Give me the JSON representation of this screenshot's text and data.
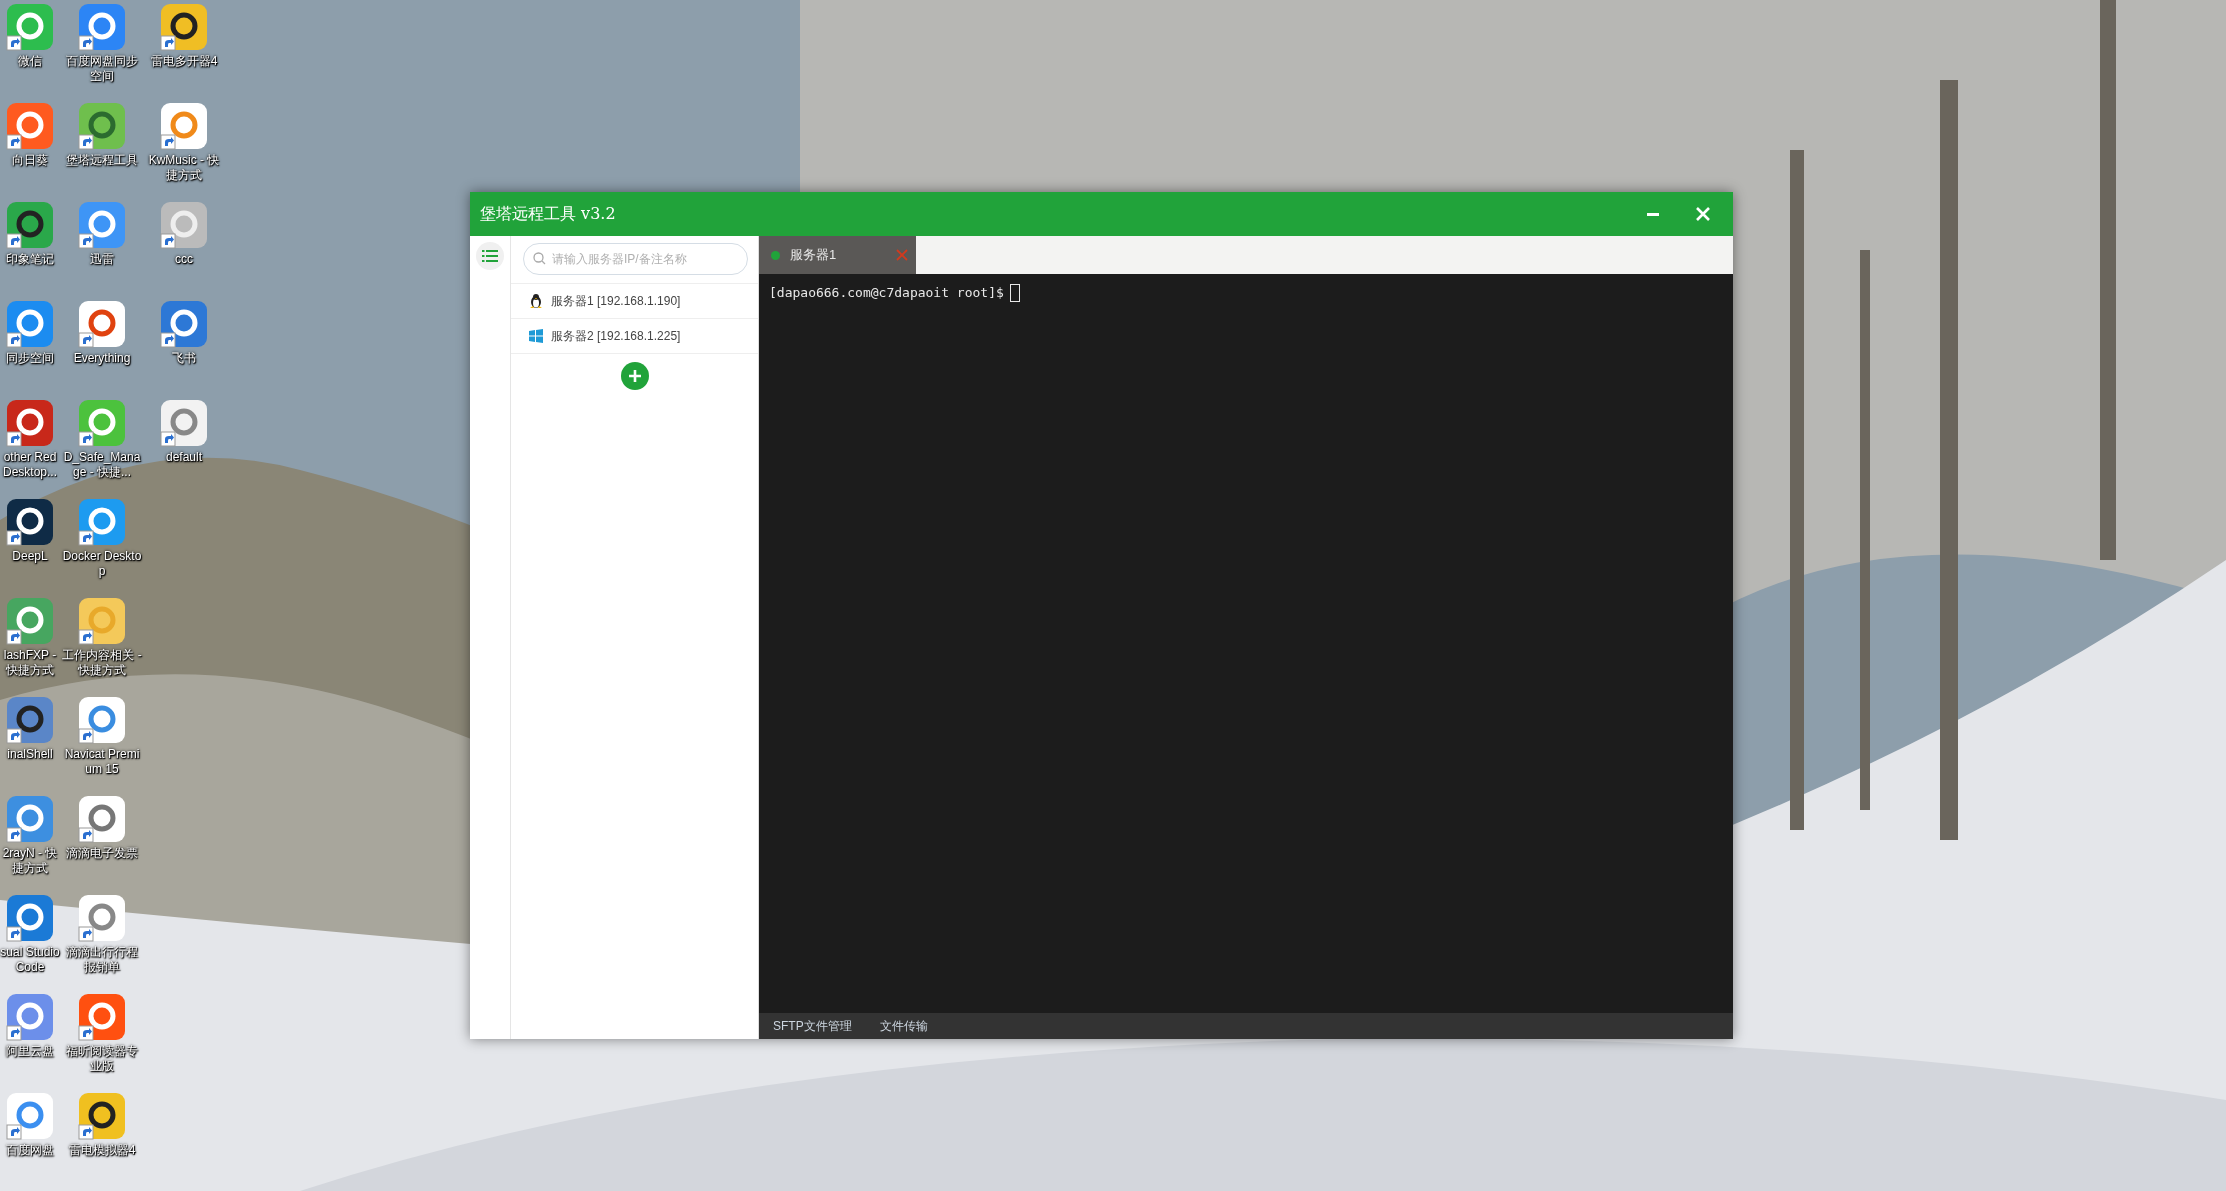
{
  "desktop": {
    "icons": [
      {
        "label": "微信"
      },
      {
        "label": "向日葵"
      },
      {
        "label": "印象笔记"
      },
      {
        "label": "同步空间"
      },
      {
        "label": "other Red Desktop..."
      },
      {
        "label": "DeepL"
      },
      {
        "label": "lashFXP - 快捷方式"
      },
      {
        "label": "inalShell"
      },
      {
        "label": "2rayN - 快捷方式"
      },
      {
        "label": "sual Studio Code"
      },
      {
        "label": "阿里云盘"
      },
      {
        "label": "百度网盘"
      },
      {
        "label": "百度网盘同步空间"
      },
      {
        "label": "堡塔远程工具"
      },
      {
        "label": "迅雷"
      },
      {
        "label": "Everything"
      },
      {
        "label": "D_Safe_Manage - 快捷..."
      },
      {
        "label": "Docker Desktop"
      },
      {
        "label": "工作内容相关 - 快捷方式"
      },
      {
        "label": "Navicat Premium 15"
      },
      {
        "label": "滴滴电子发票"
      },
      {
        "label": "滴滴出行行程报销单"
      },
      {
        "label": "福昕阅读器专业版"
      },
      {
        "label": "雷电模拟器4"
      },
      {
        "label": "雷电多开器4"
      },
      {
        "label": "KwMusic - 快捷方式"
      },
      {
        "label": "ccc"
      },
      {
        "label": "飞书"
      },
      {
        "label": "default"
      }
    ]
  },
  "window": {
    "title": "堡塔远程工具 v3.2",
    "search": {
      "placeholder": "请输入服务器IP/备注名称"
    },
    "servers": [
      {
        "name": "服务器1 [192.168.1.190]",
        "kind": "linux"
      },
      {
        "name": "服务器2 [192.168.1.225]",
        "kind": "windows"
      }
    ],
    "tabs": [
      {
        "label": "服务器1",
        "selected": true,
        "connected": true
      }
    ],
    "terminal": {
      "prompt": "[dapao666.com@c7dapaoit root]$"
    },
    "bottom_links": [
      "SFTP文件管理",
      "文件传输"
    ]
  }
}
